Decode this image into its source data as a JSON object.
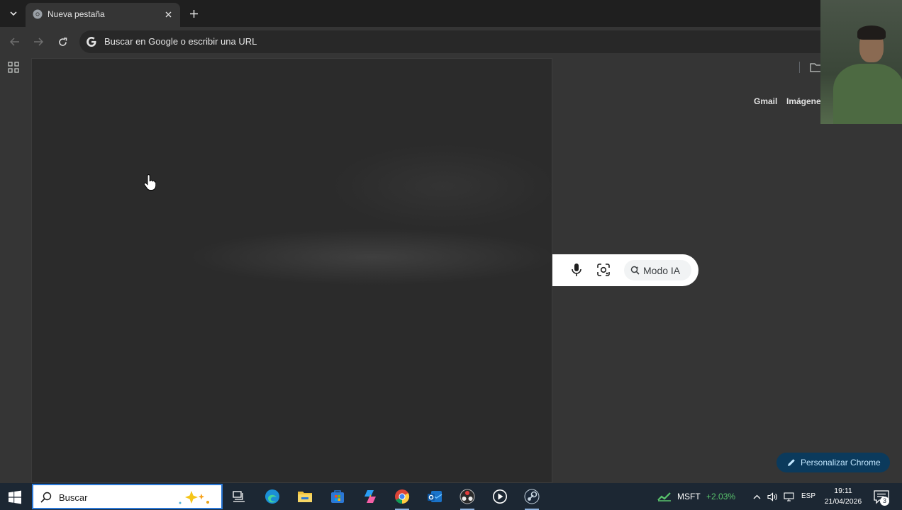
{
  "browser": {
    "tab": {
      "title": "Nueva pestaña",
      "favicon": "chrome-newtab-icon"
    },
    "omnibox": {
      "placeholder": "Buscar en Google o escribir una URL"
    }
  },
  "newtab": {
    "links": {
      "gmail": "Gmail",
      "images": "Imágene"
    },
    "search": {
      "ai_mode_label": "Modo IA"
    },
    "customize_label": "Personalizar Chrome"
  },
  "taskbar": {
    "search_placeholder": "Buscar",
    "apps": [
      "task-view-icon",
      "edge-icon",
      "file-explorer-icon",
      "ms-store-icon",
      "copilot-icon",
      "chrome-icon",
      "outlook-icon",
      "obs-icon",
      "media-player-icon",
      "steam-icon"
    ],
    "stock": {
      "symbol": "MSFT",
      "change": "+2.03%"
    },
    "language": "ESP",
    "time": "19:11",
    "date": "21/04/2026",
    "notifications": "3"
  },
  "colors": {
    "accent": "#0b3a5c",
    "accent_text": "#c2e7ff",
    "stock_up": "#59c46c"
  }
}
